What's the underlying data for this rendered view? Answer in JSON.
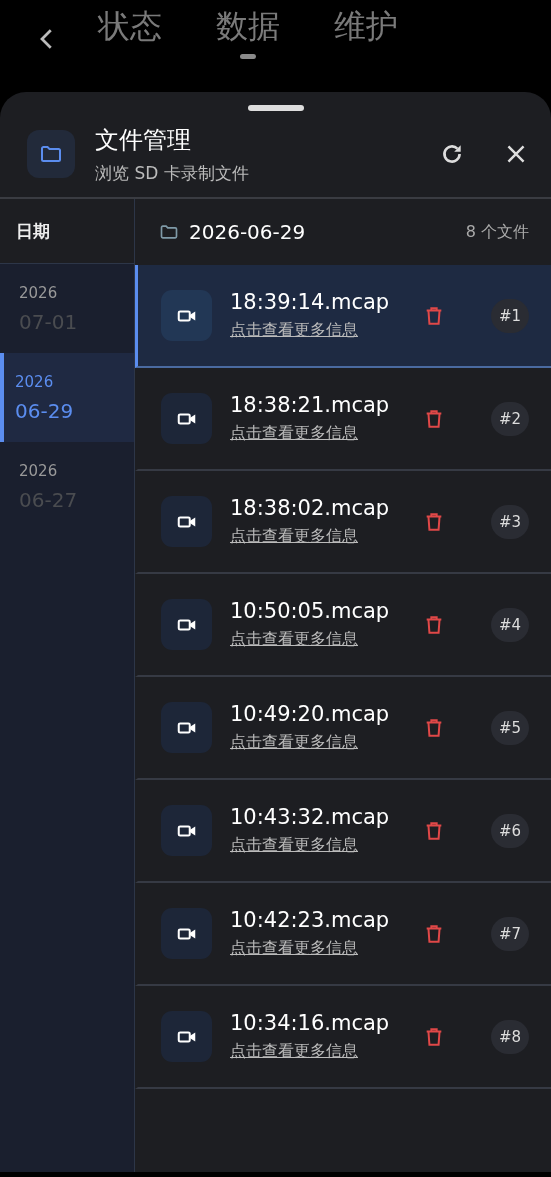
{
  "top_bar": {
    "tabs": [
      {
        "label": "状态",
        "selected": false
      },
      {
        "label": "数据",
        "selected": true
      },
      {
        "label": "维护",
        "selected": false
      }
    ]
  },
  "sheet": {
    "title": "文件管理",
    "subtitle": "浏览 SD 卡录制文件",
    "date_column": {
      "heading": "日期",
      "dates": [
        {
          "year": "2026",
          "day": "07-01",
          "selected": false
        },
        {
          "year": "2026",
          "day": "06-29",
          "selected": true
        },
        {
          "year": "2026",
          "day": "06-27",
          "selected": false
        }
      ]
    },
    "folder": {
      "date": "2026-06-29",
      "count": "8 个文件"
    },
    "files": [
      {
        "name": "18:39:14.mcap",
        "link": "点击查看更多信息",
        "index": "#1",
        "selected": true
      },
      {
        "name": "18:38:21.mcap",
        "link": "点击查看更多信息",
        "index": "#2",
        "selected": false
      },
      {
        "name": "18:38:02.mcap",
        "link": "点击查看更多信息",
        "index": "#3",
        "selected": false
      },
      {
        "name": "10:50:05.mcap",
        "link": "点击查看更多信息",
        "index": "#4",
        "selected": false
      },
      {
        "name": "10:49:20.mcap",
        "link": "点击查看更多信息",
        "index": "#5",
        "selected": false
      },
      {
        "name": "10:43:32.mcap",
        "link": "点击查看更多信息",
        "index": "#6",
        "selected": false
      },
      {
        "name": "10:42:23.mcap",
        "link": "点击查看更多信息",
        "index": "#7",
        "selected": false
      },
      {
        "name": "10:34:16.mcap",
        "link": "点击查看更多信息",
        "index": "#8",
        "selected": false
      }
    ]
  }
}
